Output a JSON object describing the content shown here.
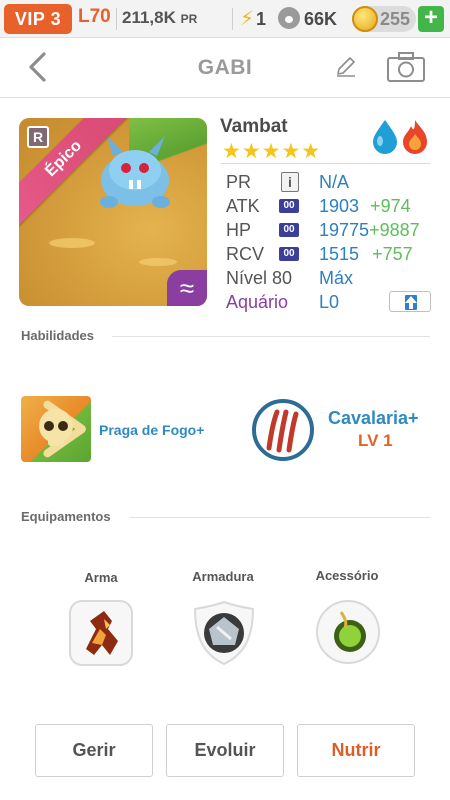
{
  "topbar": {
    "vip": "VIP 3",
    "level": "L70",
    "power_value": "211,8K",
    "power_unit": "PR",
    "energy": "1",
    "paw_count": "66K",
    "coins": "255",
    "add_symbol": "+"
  },
  "header": {
    "title": "GABI",
    "icons": [
      "back-arrow-icon",
      "pencil-edit-icon",
      "camera-icon"
    ]
  },
  "monster": {
    "name": "Vambat",
    "rarity": "Épico",
    "rank_badge": "R",
    "stars": "★★★★★",
    "star_count": 5,
    "elements": [
      "water-drop-icon",
      "fire-icon"
    ],
    "element_colors": [
      "#1f9fd6",
      "#e8452a"
    ],
    "stats": {
      "pr_label": "PR",
      "pr_info": "i",
      "pr_value": "N/A",
      "atk_label": "ATK",
      "atk_value": "1903",
      "atk_bonus": "+974",
      "hp_label": "HP",
      "hp_value": "19775",
      "hp_bonus": "+9887",
      "rcv_label": "RCV",
      "rcv_value": "1515",
      "rcv_bonus": "+757",
      "stat_badge": "00",
      "level_label": "Nível 80",
      "level_value": "Máx",
      "aquarium_label": "Aquário",
      "aquarium_value": "L0"
    }
  },
  "skills": {
    "section_title": "Habilidades",
    "skill1_name": "Praga de Fogo+",
    "skill2_name": "Cavalaria+",
    "skill2_level": "LV 1"
  },
  "equipment": {
    "section_title": "Equipamentos",
    "weapon_label": "Arma",
    "armor_label": "Armadura",
    "accessory_label": "Acessório"
  },
  "actions": {
    "manage": "Gerir",
    "evolve": "Evoluir",
    "feed": "Nutrir"
  },
  "colors": {
    "accent_orange": "#e8612a",
    "link_blue": "#2f8ac2",
    "bonus_green": "#5cbf5a",
    "star_gold": "#f5c518",
    "epic_pink": "#e65a8a"
  }
}
